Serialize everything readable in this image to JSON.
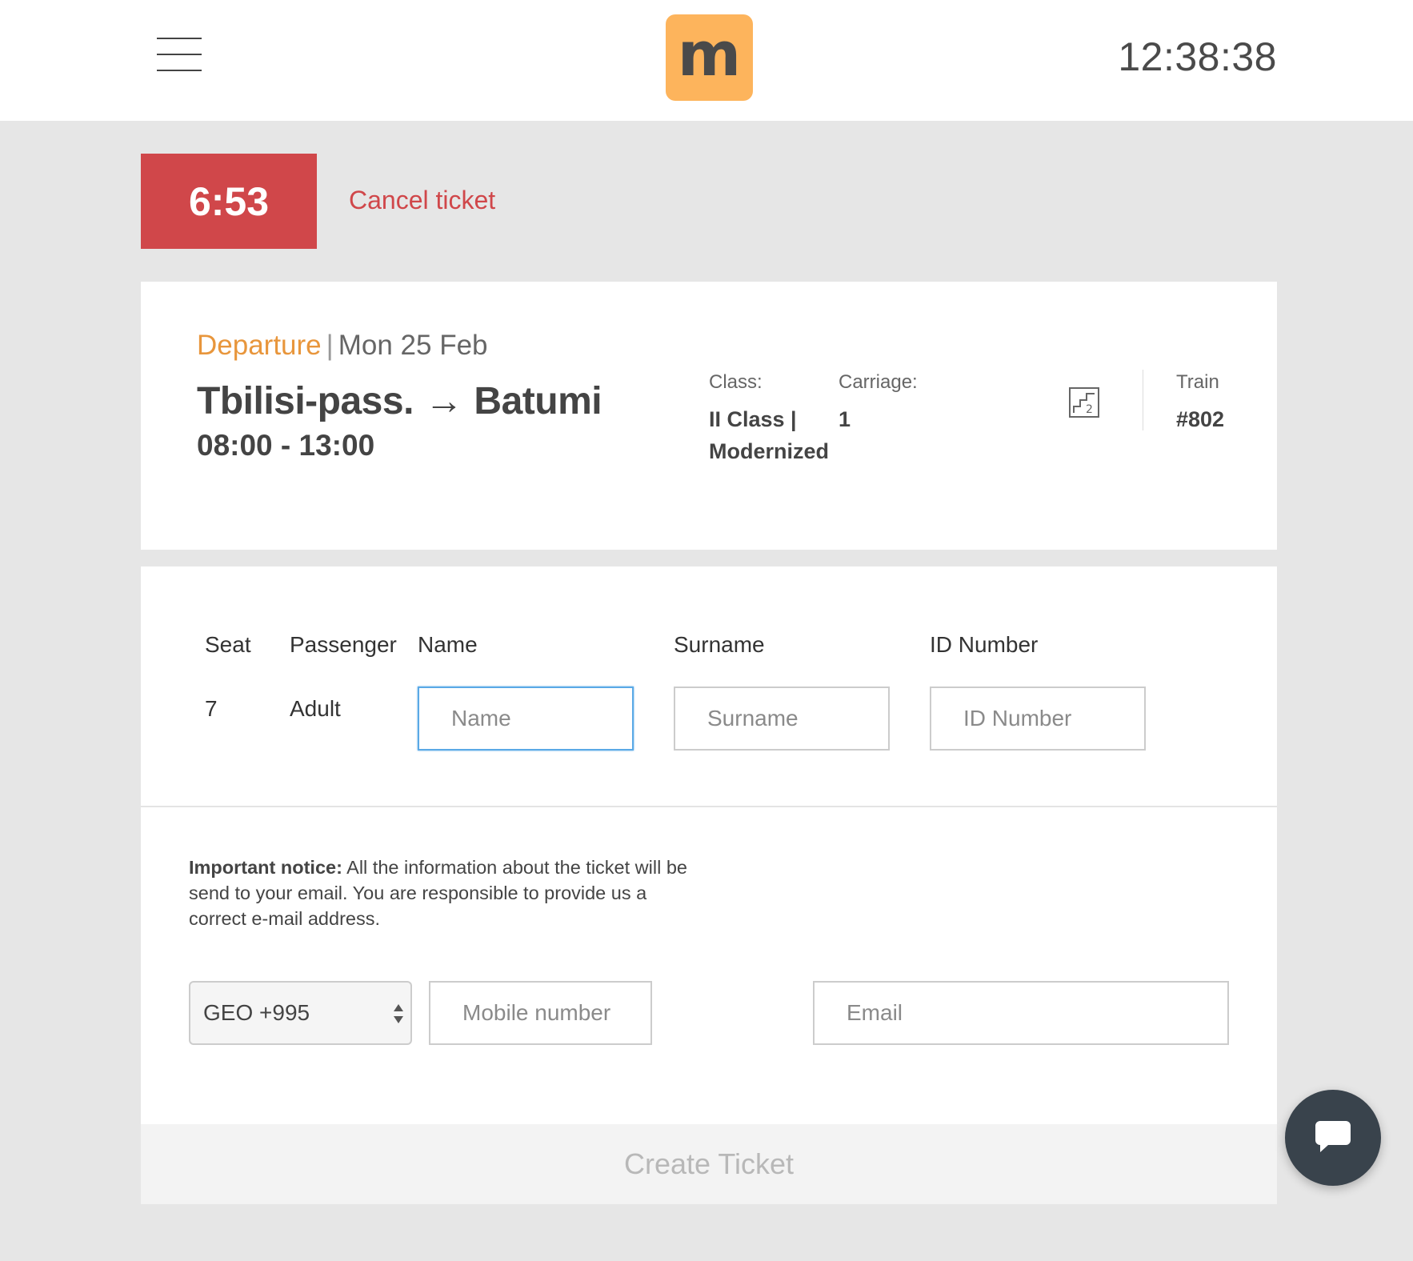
{
  "header": {
    "logo_letter": "m",
    "clock": "12:38:38",
    "accent_color": "#fdb45c"
  },
  "timer": {
    "value": "6:53",
    "color": "#d0474a"
  },
  "cancel_link": "Cancel ticket",
  "trip": {
    "direction_label": "Departure",
    "separator": "|",
    "date": "Mon 25 Feb",
    "origin": "Tbilisi-pass.",
    "arrow": "→",
    "destination": "Batumi",
    "times": "08:00 - 13:00",
    "class_label": "Class:",
    "class_value": "II Class | Modernized",
    "carriage_label": "Carriage:",
    "carriage_value": "1",
    "train_label": "Train",
    "train_value": "#802",
    "seat_map_icon": "seat-map-icon"
  },
  "passenger_table": {
    "headers": {
      "seat": "Seat",
      "passenger": "Passenger",
      "name": "Name",
      "surname": "Surname",
      "id_number": "ID Number"
    },
    "rows": [
      {
        "seat": "7",
        "passenger": "Adult",
        "name_placeholder": "Name",
        "surname_placeholder": "Surname",
        "id_placeholder": "ID Number"
      }
    ]
  },
  "notice": {
    "bold": "Important notice:",
    "text": " All the information about the ticket will be send to your email. You are responsible to provide us a correct e-mail address."
  },
  "contact": {
    "country_code": "GEO +995",
    "mobile_placeholder": "Mobile number",
    "email_placeholder": "Email"
  },
  "create_button": "Create Ticket",
  "chat_icon": "chat-bubble-icon"
}
